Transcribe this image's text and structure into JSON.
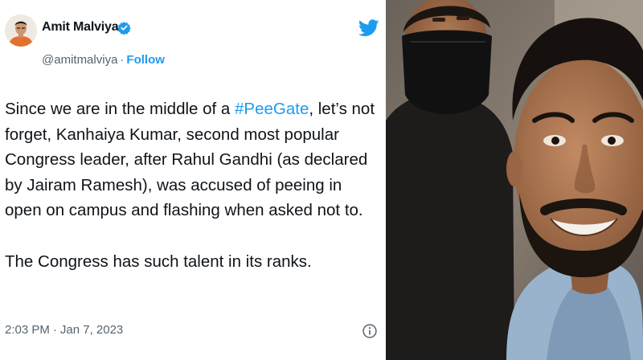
{
  "tweet": {
    "author_name": "Amit Malviya",
    "handle": "@amitmalviya",
    "separator": "·",
    "follow_label": "Follow",
    "body_before_hashtag": "Since we are in the middle of a ",
    "hashtag": "#PeeGate",
    "body_after_hashtag": ", let’s not forget, Kanhaiya Kumar, second most popular Congress leader, after Rahul Gandhi (as declared by Jairam Ramesh), was accused of peeing in open on campus and flashing when asked not to.",
    "body_second_paragraph": "The Congress has such talent in its ranks.",
    "time": "2:03 PM",
    "date": "Jan 7, 2023",
    "icons": {
      "verified": "verified-badge-icon",
      "platform": "twitter-bird-icon",
      "info": "info-icon"
    }
  },
  "colors": {
    "text": "#0f1419",
    "secondary_text": "#536471",
    "accent": "#1d9bf0"
  }
}
